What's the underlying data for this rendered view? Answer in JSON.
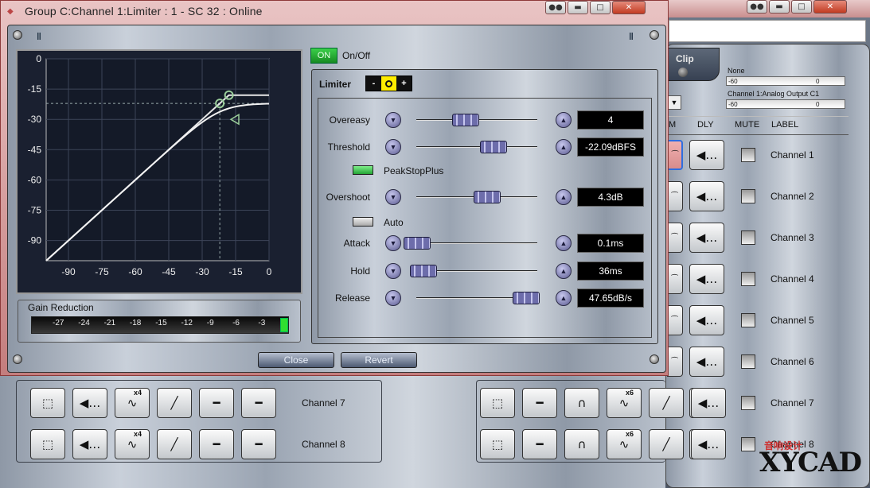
{
  "window": {
    "title": "Group C:Channel 1:Limiter : 1 - SC 32 : Online"
  },
  "background_app": {
    "clip": {
      "label": "Clip"
    },
    "meters": [
      {
        "label": "None",
        "min": "-60",
        "max": "0"
      },
      {
        "label": "Channel 1:Analog Output C1",
        "min": "-60",
        "max": "0"
      }
    ],
    "column_headers": [
      "M",
      "DLY",
      "MUTE",
      "LABEL"
    ],
    "right_channels": [
      "Channel 1",
      "Channel 2",
      "Channel 3",
      "Channel 4",
      "Channel 5",
      "Channel 6",
      "Channel 7",
      "Channel 8"
    ],
    "left_channels": [
      "Channel 7",
      "Channel 8"
    ],
    "x6_badge": "x6",
    "x4_badge": "x4"
  },
  "graph": {
    "y_ticks": [
      "0",
      "-15",
      "-30",
      "-45",
      "-60",
      "-75",
      "-90"
    ],
    "x_ticks": [
      "-90",
      "-75",
      "-60",
      "-45",
      "-30",
      "-15",
      "0"
    ],
    "axis_range": [
      -100,
      0
    ],
    "grid": true,
    "threshold_db": -22.09,
    "ceiling_db": -18
  },
  "gain_reduction": {
    "title": "Gain Reduction",
    "ticks": [
      "-27",
      "-24",
      "-21",
      "-18",
      "-15",
      "-12",
      "-9",
      "-6",
      "-3"
    ]
  },
  "onoff": {
    "button": "ON",
    "label": "On/Off"
  },
  "limiter": {
    "title": "Limiter",
    "steps": [
      "-",
      "+"
    ],
    "params": {
      "overeasy": {
        "label": "Overeasy",
        "value": "4",
        "position": 0.4
      },
      "threshold": {
        "label": "Threshold",
        "value": "-22.09dBFS",
        "position": 0.63
      },
      "overshoot": {
        "label": "Overshoot",
        "value": "4.3dB",
        "position": 0.58
      },
      "attack": {
        "label": "Attack",
        "value": "0.1ms",
        "position": 0.0
      },
      "hold": {
        "label": "Hold",
        "value": "36ms",
        "position": 0.05
      },
      "release": {
        "label": "Release",
        "value": "47.65dB/s",
        "position": 0.9
      }
    },
    "peakstopplus": {
      "label": "PeakStopPlus",
      "on": true
    },
    "auto": {
      "label": "Auto",
      "on": false
    }
  },
  "footer": {
    "close": "Close",
    "revert": "Revert"
  },
  "watermark": {
    "cn": "音响设计",
    "logo": "XYCAD"
  },
  "colors": {
    "accent_green": "#23a335",
    "title_bar": "#c47d7d",
    "graph_bg": "#1a2030"
  }
}
